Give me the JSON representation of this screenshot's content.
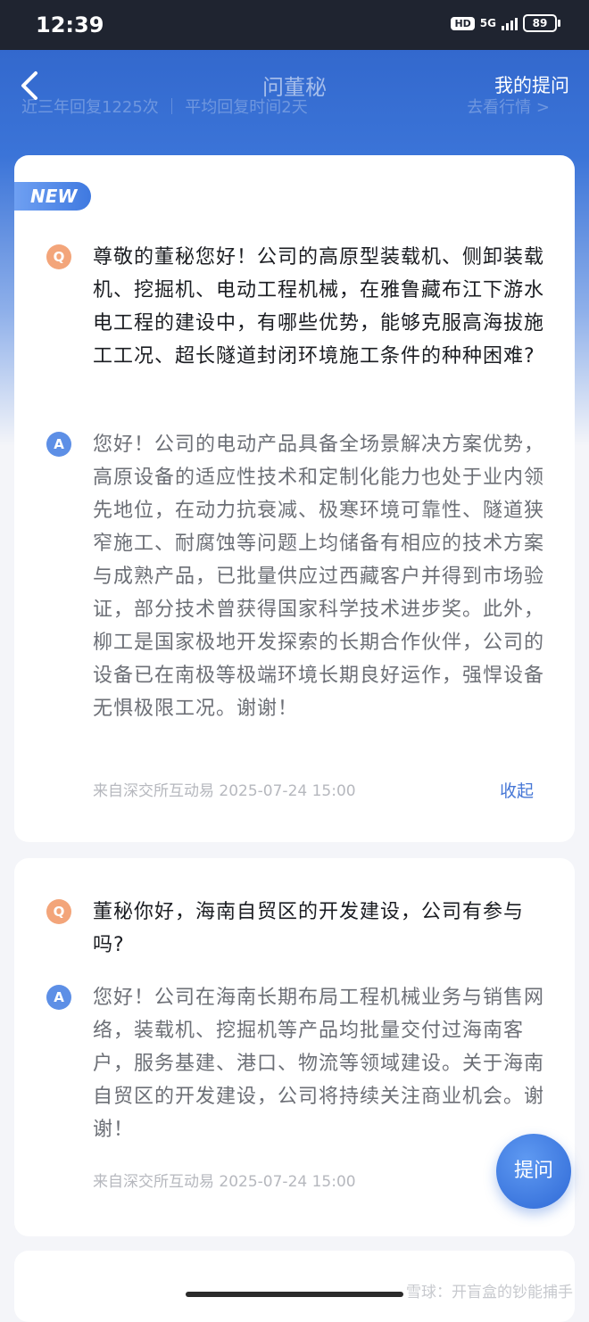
{
  "status_bar": {
    "time": "12:39",
    "hd": "HD",
    "network": "5G",
    "battery": "89"
  },
  "nav": {
    "title": "问董秘",
    "my_questions": "我的提问",
    "stats": "近三年回复1225次 ｜ 平均回复时间2天",
    "market_link": "去看行情 >"
  },
  "cards": [
    {
      "badge": "NEW",
      "q_label": "Q",
      "question": "尊敬的董秘您好！公司的高原型装载机、侧卸装载机、挖掘机、电动工程机械，在雅鲁藏布江下游水电工程的建设中，有哪些优势，能够克服高海拔施工工况、超长隧道封闭环境施工条件的种种困难?",
      "a_label": "A",
      "answer": "您好！公司的电动产品具备全场景解决方案优势，高原设备的适应性技术和定制化能力也处于业内领先地位，在动力抗衰减、极寒环境可靠性、隧道狭窄施工、耐腐蚀等问题上均储备有相应的技术方案与成熟产品，已批量供应过西藏客户并得到市场验证，部分技术曾获得国家科学技术进步奖。此外，柳工是国家极地开发探索的长期合作伙伴，公司的设备已在南极等极端环境长期良好运作，强悍设备无惧极限工况。谢谢！",
      "source": "来自深交所互动易 2025-07-24 15:00",
      "collapse": "收起"
    },
    {
      "q_label": "Q",
      "question": "董秘你好，海南自贸区的开发建设，公司有参与吗?",
      "a_label": "A",
      "answer": "您好！公司在海南长期布局工程机械业务与销售网络，装载机、挖掘机等产品均批量交付过海南客户，服务基建、港口、物流等领域建设。关于海南自贸区的开发建设，公司将持续关注商业机会。谢谢！",
      "source": "来自深交所互动易 2025-07-24 15:00"
    }
  ],
  "fab": {
    "label": "提问"
  },
  "watermark": "雪球：开盲盒的钞能捕手",
  "colors": {
    "accent": "#4677d6",
    "q_icon": "#f3a57a",
    "a_icon": "#5d8fe6",
    "header_blue": "#2f63c8"
  }
}
